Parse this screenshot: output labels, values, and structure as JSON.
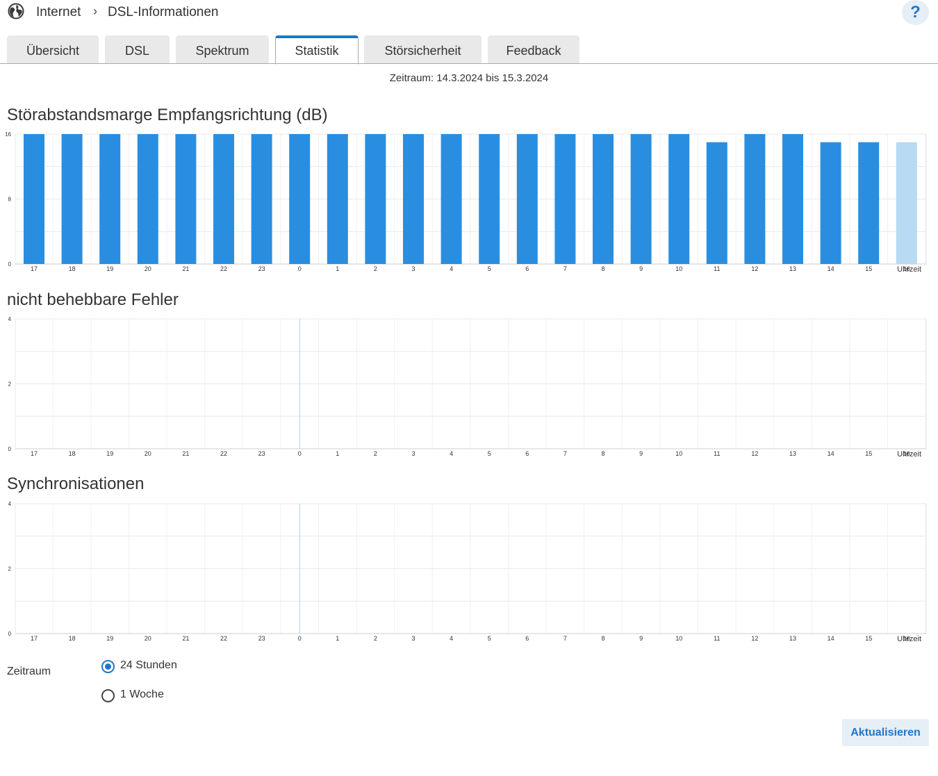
{
  "breadcrumb": {
    "root": "Internet",
    "page": "DSL-Informationen",
    "separator": "›"
  },
  "help": {
    "label": "?"
  },
  "tabs": [
    {
      "label": "Übersicht",
      "active": false
    },
    {
      "label": "DSL",
      "active": false
    },
    {
      "label": "Spektrum",
      "active": false
    },
    {
      "label": "Statistik",
      "active": true
    },
    {
      "label": "Störsicherheit",
      "active": false
    },
    {
      "label": "Feedback",
      "active": false
    }
  ],
  "period_text": "Zeitraum: 14.3.2024 bis 15.3.2024",
  "colors": {
    "accent": "#2176c9",
    "bar": "#2a8ee0",
    "bar_current": "#b8daf3",
    "grid": "#e8e8e8"
  },
  "chart_data": [
    {
      "type": "bar",
      "title": "Störabstandsmarge Empfangsrichtung (dB)",
      "categories": [
        "17",
        "18",
        "19",
        "20",
        "21",
        "22",
        "23",
        "0",
        "1",
        "2",
        "3",
        "4",
        "5",
        "6",
        "7",
        "8",
        "9",
        "10",
        "11",
        "12",
        "13",
        "14",
        "15",
        "16"
      ],
      "values": [
        16,
        16,
        16,
        16,
        16,
        16,
        16,
        16,
        16,
        16,
        16,
        16,
        16,
        16,
        16,
        16,
        16,
        16,
        15,
        16,
        16,
        15,
        15,
        15
      ],
      "current_index": 23,
      "xlabel": "Uhrzeit",
      "y_ticks": [
        "16",
        "8",
        "0"
      ],
      "ylim": [
        0,
        16
      ]
    },
    {
      "type": "bar",
      "title": "nicht behebbare Fehler",
      "categories": [
        "17",
        "18",
        "19",
        "20",
        "21",
        "22",
        "23",
        "0",
        "1",
        "2",
        "3",
        "4",
        "5",
        "6",
        "7",
        "8",
        "9",
        "10",
        "11",
        "12",
        "13",
        "14",
        "15",
        "16"
      ],
      "values": [
        0,
        0,
        0,
        0,
        0,
        0,
        0,
        0,
        0,
        0,
        0,
        0,
        0,
        0,
        0,
        0,
        0,
        0,
        0,
        0,
        0,
        0,
        0,
        0
      ],
      "marker_index": 7,
      "xlabel": "Uhrzeit",
      "y_ticks": [
        "4",
        "2",
        "0"
      ],
      "ylim": [
        0,
        4
      ]
    },
    {
      "type": "bar",
      "title": "Synchronisationen",
      "categories": [
        "17",
        "18",
        "19",
        "20",
        "21",
        "22",
        "23",
        "0",
        "1",
        "2",
        "3",
        "4",
        "5",
        "6",
        "7",
        "8",
        "9",
        "10",
        "11",
        "12",
        "13",
        "14",
        "15",
        "16"
      ],
      "values": [
        0,
        0,
        0,
        0,
        0,
        0,
        0,
        0,
        0,
        0,
        0,
        0,
        0,
        0,
        0,
        0,
        0,
        0,
        0,
        0,
        0,
        0,
        0,
        0
      ],
      "marker_index": 7,
      "xlabel": "Uhrzeit",
      "y_ticks": [
        "4",
        "2",
        "0"
      ],
      "ylim": [
        0,
        4
      ]
    }
  ],
  "form": {
    "label": "Zeitraum",
    "options": [
      {
        "label": "24 Stunden",
        "checked": true
      },
      {
        "label": "1 Woche",
        "checked": false
      }
    ],
    "refresh_label": "Aktualisieren"
  }
}
